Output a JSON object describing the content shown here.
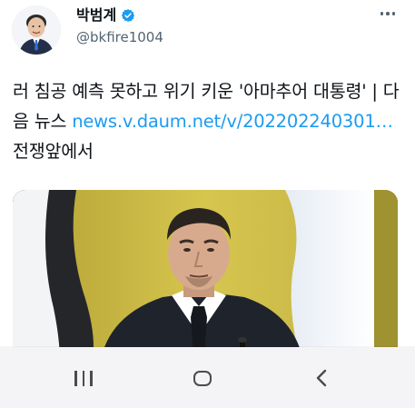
{
  "tweet": {
    "display_name": "박범계",
    "handle": "@bkfire1004",
    "text_before_link": "러 침공 예측 못하고 위기 키운 '아마추어 대통령' | 다음 뉴스 ",
    "link_text": "news.v.daum.net/v/202202240301…",
    "text_after_link": " 전쟁앞에서"
  },
  "icons": {
    "verified": "verified-badge-icon",
    "more": "more-options-icon",
    "recent_apps": "recent-apps-icon",
    "home": "home-icon",
    "back": "back-icon"
  },
  "colors": {
    "link": "#1d9bf0",
    "verified": "#1d9bf0",
    "text": "#0f1419",
    "muted": "#536471"
  }
}
